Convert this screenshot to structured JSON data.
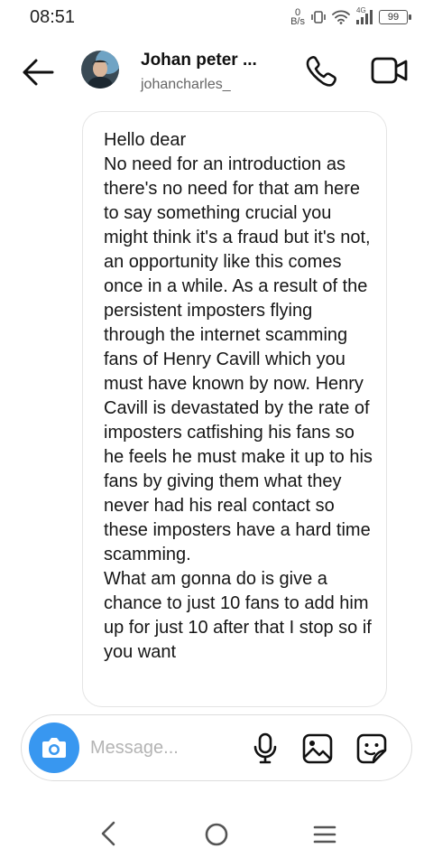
{
  "status_bar": {
    "time": "08:51",
    "net_speed_value": "0",
    "net_speed_unit": "B/s",
    "network_type": "4G",
    "battery_level": "99"
  },
  "header": {
    "contact_name": "Johan peter ...",
    "contact_handle": "johancharles_"
  },
  "message": {
    "text": "Hello dear\nNo need for an introduction as there's no need for that am here to say something crucial you might think it's a fraud but it's not, an opportunity like this comes once in a while. As a result of the persistent imposters flying through the internet scamming fans of Henry Cavill which you must have known by now. Henry Cavill is devastated by the rate of imposters catfishing his fans so he feels he must make it up to his fans by giving them what they never had his real contact so these imposters have a hard time scamming.\nWhat am gonna do is give a chance to just 10 fans to add him up for just 10 after that I stop so if you want"
  },
  "composer": {
    "placeholder": "Message...",
    "value": ""
  },
  "icons": {
    "back": "arrow-left-icon",
    "call": "phone-icon",
    "video": "video-camera-icon",
    "camera": "camera-icon",
    "mic": "microphone-icon",
    "gallery": "image-icon",
    "sticker": "sticker-icon"
  },
  "colors": {
    "camera_button": "#3897f0",
    "placeholder": "#b4b4b4"
  }
}
